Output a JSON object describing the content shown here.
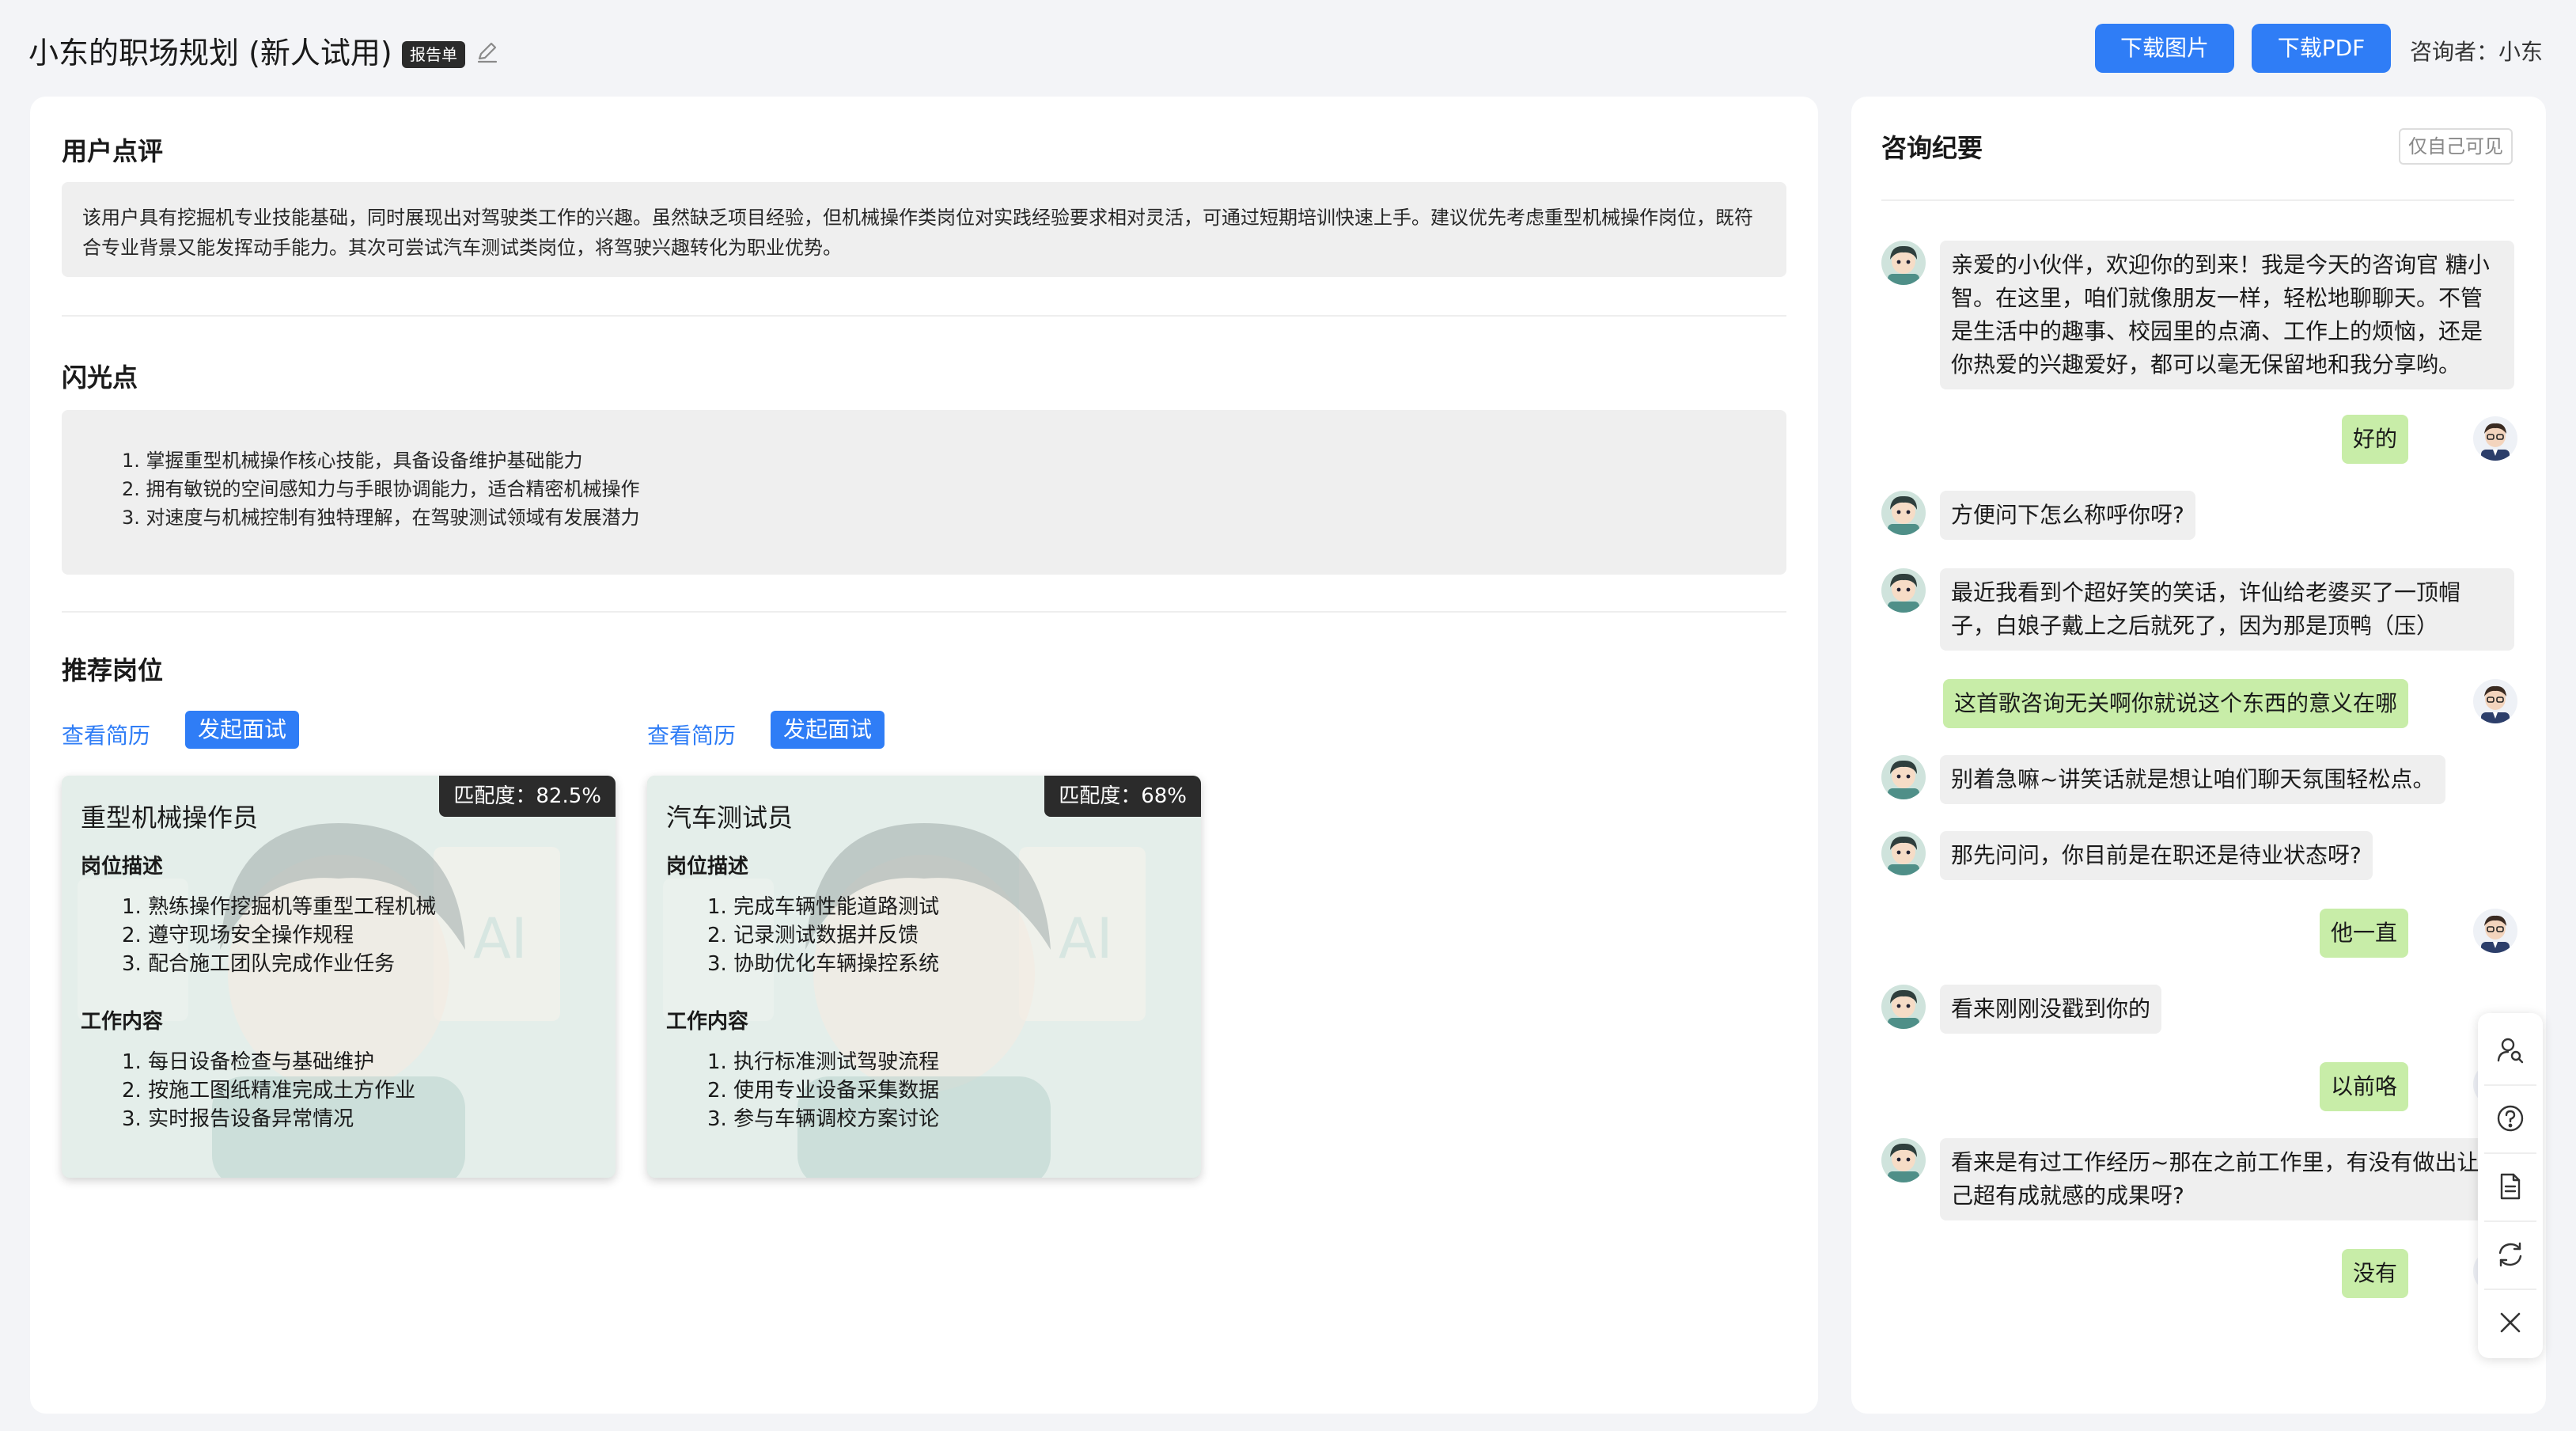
{
  "header": {
    "title": "小东的职场规划 (新人试用)",
    "badge": "报告单",
    "download_image": "下载图片",
    "download_pdf": "下载PDF",
    "consultant": "咨询者：小东"
  },
  "review": {
    "title": "用户点评",
    "text": "该用户具有挖掘机专业技能基础，同时展现出对驾驶类工作的兴趣。虽然缺乏项目经验，但机械操作类岗位对实践经验要求相对灵活，可通过短期培训快速上手。建议优先考虑重型机械操作岗位，既符合专业背景又能发挥动手能力。其次可尝试汽车测试类岗位，将驾驶兴趣转化为职业优势。"
  },
  "highlights": {
    "title": "闪光点",
    "items": [
      "1. 掌握重型机械操作核心技能，具备设备维护基础能力",
      "2. 拥有敏锐的空间感知力与手眼协调能力，适合精密机械操作",
      "3. 对速度与机械控制有独特理解，在驾驶测试领域有发展潜力"
    ]
  },
  "jobs": {
    "title": "推荐岗位",
    "list": [
      {
        "view_resume": "查看简历",
        "start_interview": "发起面试",
        "match": "匹配度：82.5%",
        "name": "重型机械操作员",
        "desc_label": "岗位描述",
        "desc": [
          "1. 熟练操作挖掘机等重型工程机械",
          "2. 遵守现场安全操作规程",
          "3. 配合施工团队完成作业任务"
        ],
        "work_label": "工作内容",
        "work": [
          "1. 每日设备检查与基础维护",
          "2. 按施工图纸精准完成土方作业",
          "3. 实时报告设备异常情况"
        ]
      },
      {
        "view_resume": "查看简历",
        "start_interview": "发起面试",
        "match": "匹配度：68%",
        "name": "汽车测试员",
        "desc_label": "岗位描述",
        "desc": [
          "1. 完成车辆性能道路测试",
          "2. 记录测试数据并反馈",
          "3. 协助优化车辆操控系统"
        ],
        "work_label": "工作内容",
        "work": [
          "1. 执行标准测试驾驶流程",
          "2. 使用专业设备采集数据",
          "3. 参与车辆调校方案讨论"
        ]
      }
    ]
  },
  "chat": {
    "title": "咨询纪要",
    "private_tag": "仅自己可见",
    "messages": [
      {
        "role": "bot",
        "text": "亲爱的小伙伴，欢迎你的到来！我是今天的咨询官 糖小智。在这里，咱们就像朋友一样，轻松地聊聊天。不管是生活中的趣事、校园里的点滴、工作上的烦恼，还是你热爱的兴趣爱好，都可以毫无保留地和我分享哟。"
      },
      {
        "role": "user",
        "text": "好的"
      },
      {
        "role": "bot",
        "text": "方便问下怎么称呼你呀?"
      },
      {
        "role": "bot",
        "text": "最近我看到个超好笑的笑话，许仙给老婆买了一顶帽子，白娘子戴上之后就死了，因为那是顶鸭（压）"
      },
      {
        "role": "user",
        "text": "这首歌咨询无关啊你就说这个东西的意义在哪"
      },
      {
        "role": "bot",
        "text": "别着急嘛~讲笑话就是想让咱们聊天氛围轻松点。"
      },
      {
        "role": "bot",
        "text": "那先问问，你目前是在职还是待业状态呀?"
      },
      {
        "role": "user",
        "text": "他一直"
      },
      {
        "role": "bot",
        "text": "看来刚刚没戳到你的"
      },
      {
        "role": "user",
        "text": "以前咯"
      },
      {
        "role": "bot",
        "text": "看来是有过工作经历~那在之前工作里，有没有做出让自己超有成就感的成果呀?"
      },
      {
        "role": "user",
        "text": "没有"
      }
    ]
  },
  "toolbar": {
    "icons": [
      "user-search-icon",
      "help-icon",
      "document-icon",
      "refresh-icon",
      "close-icon"
    ]
  },
  "colors": {
    "primary": "#2f7df6",
    "user_bubble": "#c8eda8",
    "bot_bubble": "#efefef",
    "badge_dark": "#2b2b2b"
  }
}
